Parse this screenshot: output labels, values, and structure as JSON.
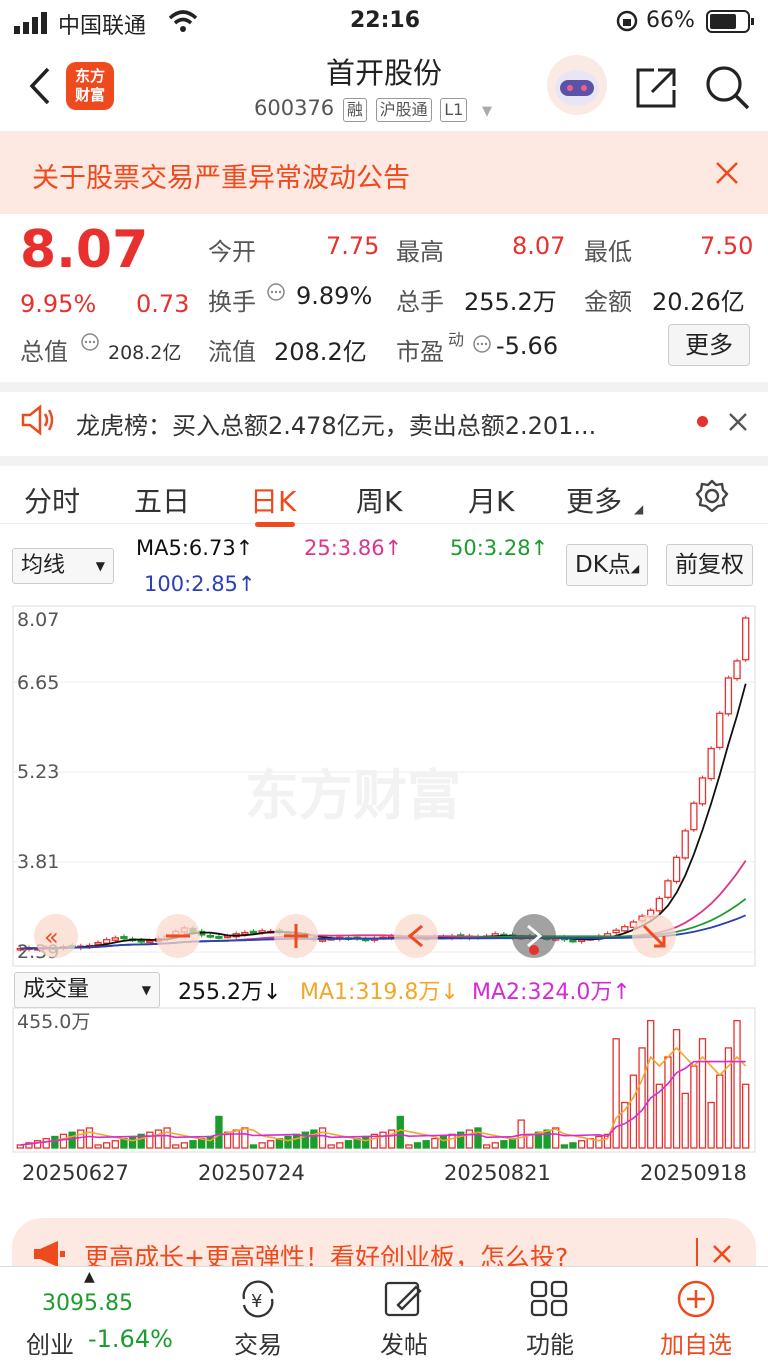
{
  "status_bar": {
    "carrier": "中国联通",
    "time": "22:16",
    "battery": "66%"
  },
  "header": {
    "logo_line1": "东方",
    "logo_line2": "财富",
    "title": "首开股份",
    "code": "600376",
    "tags": [
      "融",
      "沪股通",
      "L1"
    ]
  },
  "notice": {
    "text": "关于股票交易严重异常波动公告"
  },
  "quote": {
    "price": "8.07",
    "pct": "9.95%",
    "change": "0.73",
    "total_value_label": "总值",
    "total_value": "208.2亿",
    "open_label": "今开",
    "open": "7.75",
    "high_label": "最高",
    "high": "8.07",
    "low_label": "最低",
    "low": "7.50",
    "turnover_label": "换手",
    "turnover": "9.89%",
    "volume_label": "总手",
    "volume": "255.2万",
    "amount_label": "金额",
    "amount": "20.26亿",
    "float_label": "流值",
    "float_value": "208.2亿",
    "pe_label": "市盈",
    "pe_sup": "动",
    "pe": "-5.66",
    "more_label": "更多"
  },
  "lhb": {
    "text": "龙虎榜：买入总额2.478亿元，卖出总额2.201..."
  },
  "tabs": {
    "items": [
      "分时",
      "五日",
      "日K",
      "周K",
      "月K",
      "更多"
    ],
    "active": 2
  },
  "ma_bar": {
    "selector": "均线",
    "ma5": "MA5:6.73↑",
    "ma25": "25:3.86↑",
    "ma50": "50:3.28↑",
    "ma100": "100:2.85↑",
    "dk": "DK点",
    "fq": "前复权"
  },
  "kline": {
    "y_ticks": [
      "8.07",
      "6.65",
      "5.23",
      "3.81",
      "2.39"
    ],
    "watermark": "东方财富"
  },
  "vol_bar": {
    "selector": "成交量",
    "vol": "255.2万↓",
    "ma1": "MA1:319.8万↓",
    "ma2": "MA2:324.0万↑",
    "top_label": "455.0万"
  },
  "x_dates": [
    "20250627",
    "20250724",
    "20250821",
    "20250918"
  ],
  "promo": {
    "text": "更高成长+更高弹性！看好创业板，怎么投?"
  },
  "bottom": {
    "index_value": "3095.85",
    "index_name": "创业",
    "index_change": "-1.64%",
    "items": [
      "交易",
      "发帖",
      "功能",
      "加自选"
    ]
  },
  "colors": {
    "up": "#e8312f",
    "down": "#1a9d2c",
    "accent": "#ef4a1e"
  },
  "chart_data": {
    "type": "candlestick",
    "ylim": [
      2.39,
      8.07
    ],
    "closes": [
      2.45,
      2.46,
      2.45,
      2.47,
      2.46,
      2.48,
      2.47,
      2.49,
      2.5,
      2.55,
      2.6,
      2.63,
      2.62,
      2.6,
      2.56,
      2.58,
      2.62,
      2.66,
      2.74,
      2.8,
      2.72,
      2.68,
      2.66,
      2.64,
      2.66,
      2.7,
      2.72,
      2.73,
      2.75,
      2.74,
      2.72,
      2.7,
      2.68,
      2.64,
      2.6,
      2.6,
      2.62,
      2.64,
      2.62,
      2.62,
      2.6,
      2.62,
      2.64,
      2.66,
      2.64,
      2.66,
      2.64,
      2.62,
      2.66,
      2.64,
      2.66,
      2.64,
      2.66,
      2.64,
      2.66,
      2.7,
      2.66,
      2.64,
      2.64,
      2.66,
      2.64,
      2.62,
      2.62,
      2.6,
      2.58,
      2.6,
      2.62,
      2.66,
      2.7,
      2.76,
      2.82,
      2.9,
      3.0,
      3.1,
      3.3,
      3.6,
      4.0,
      4.45,
      4.92,
      5.35,
      5.85,
      6.45,
      7.05,
      7.34,
      8.07
    ],
    "volume_ylim": [
      0,
      455
    ]
  }
}
